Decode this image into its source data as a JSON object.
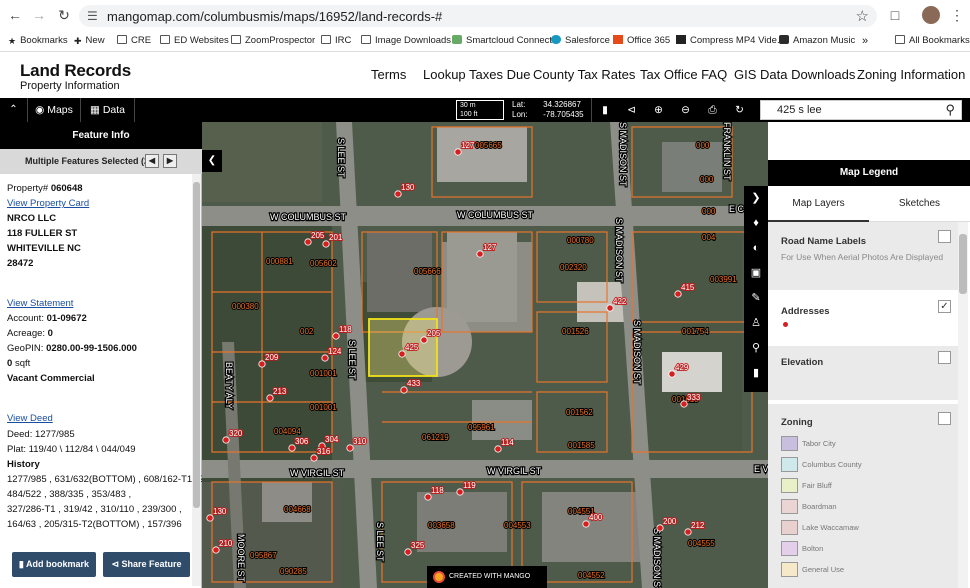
{
  "browser": {
    "url": "mangomap.com/columbusmis/maps/16952/land-records-#",
    "bookmarks": [
      "Bookmarks",
      "New",
      "CRE",
      "ED Websites",
      "ZoomProspector",
      "IRC",
      "Image Downloads",
      "Smartcloud Connect",
      "Salesforce",
      "Office 365",
      "Compress MP4 Vide...",
      "Amazon Music",
      "All Bookmarks"
    ]
  },
  "header": {
    "title": "Land Records",
    "subtitle": "Property Information",
    "nav": [
      "Terms",
      "Lookup Taxes Due",
      "County Tax Rates",
      "Tax Office FAQ",
      "GIS Data Downloads",
      "Zoning Information"
    ]
  },
  "toolbar": {
    "maps_label": "Maps",
    "data_label": "Data",
    "scale_m": "30 m",
    "scale_ft": "100 ft",
    "lat_label": "Lat:",
    "lat_value": "34.326867",
    "lon_label": "Lon:",
    "lon_value": "-78.705435",
    "search_value": "425 s lee"
  },
  "feature_info": {
    "title": "Feature Info",
    "selection": "Multiple Features Selected (2/2)",
    "property_label": "Property#",
    "property_value": "060648",
    "view_property_card": "View Property Card",
    "owner_lines": [
      "NRCO LLC",
      "118 FULLER ST",
      "WHITEVILLE NC",
      "28472"
    ],
    "view_statement": "View Statement",
    "account_label": "Account:",
    "account_value": "01-09672",
    "acreage_label": "Acreage:",
    "acreage_value": "0",
    "geopin_label": "GeoPIN:",
    "geopin_value": "0280.00-99-1506.000",
    "sqft_value": "0",
    "sqft_label": "sqft",
    "use_value": "Vacant Commercial",
    "view_deed": "View Deed",
    "deed_label": "Deed:",
    "deed_value": "1277/985",
    "plat_label": "Plat:",
    "plat_value": "119/40 \\ 112/84 \\ 044/049",
    "history_label": "History",
    "history_lines": [
      "1277/985 , 631/632(BOTTOM) , 608/162-T1&2 ,",
      "484/522 , 388/335 , 353/483 ,",
      "327/286-T1 , 319/42 , 310/110 , 239/300 ,",
      "164/63 , 205/315-T2(BOTTOM) , 157/396"
    ],
    "add_bookmark": "Add bookmark",
    "share_feature": "Share Feature"
  },
  "map": {
    "streets": [
      "W COLUMBUS ST",
      "W COLUMBUS ST",
      "W VIRGIL ST",
      "W VIRGIL ST",
      "S LEE ST",
      "S LEE ST",
      "S LEE ST",
      "S MADISON ST",
      "S MADISON ST",
      "S MADISON ST",
      "S MADISON ST",
      "BEATY ALY",
      "MOORE ST",
      "FRANKLIN ST",
      "E C",
      "E V"
    ],
    "parcel_ids": [
      "005665",
      "005666",
      "000780",
      "002320",
      "001526",
      "001754",
      "003991",
      "000881",
      "005602",
      "000380",
      "002",
      "001001",
      "001001",
      "004094",
      "061219",
      "001562",
      "095961",
      "001585",
      "001610",
      "004668",
      "003658",
      "004553",
      "004551",
      "095867",
      "090285",
      "004552",
      "004555",
      "000",
      "000",
      "004",
      "000"
    ],
    "address_labels": [
      "127",
      "130",
      "127",
      "205",
      "201",
      "205",
      "118",
      "124",
      "209",
      "213",
      "306",
      "304",
      "310",
      "316",
      "320",
      "425",
      "433",
      "422",
      "415",
      "429",
      "333",
      "119",
      "118",
      "114",
      "130",
      "210",
      "325",
      "400",
      "200",
      "212"
    ],
    "credit": "CREATED WITH MANGO"
  },
  "legend": {
    "title": "Map Legend",
    "tabs": [
      "Map Layers",
      "Sketches"
    ],
    "road_names_title": "Road Name Labels",
    "road_names_sub": "For Use When Aerial Photos Are Displayed",
    "addresses_title": "Addresses",
    "addresses_check": "✓",
    "elevation_title": "Elevation",
    "zoning_title": "Zoning",
    "zoning_items": [
      {
        "label": "Tabor City",
        "color": "#c8bfdf"
      },
      {
        "label": "Columbus County",
        "color": "#cfe8ec"
      },
      {
        "label": "Fair Bluff",
        "color": "#e9f0c8"
      },
      {
        "label": "Boardman",
        "color": "#ead4d4"
      },
      {
        "label": "Lake Waccamaw",
        "color": "#e8d0ce"
      },
      {
        "label": "Bolton",
        "color": "#e3cfea"
      },
      {
        "label": "General Use",
        "color": "#f5e9c9"
      }
    ]
  }
}
